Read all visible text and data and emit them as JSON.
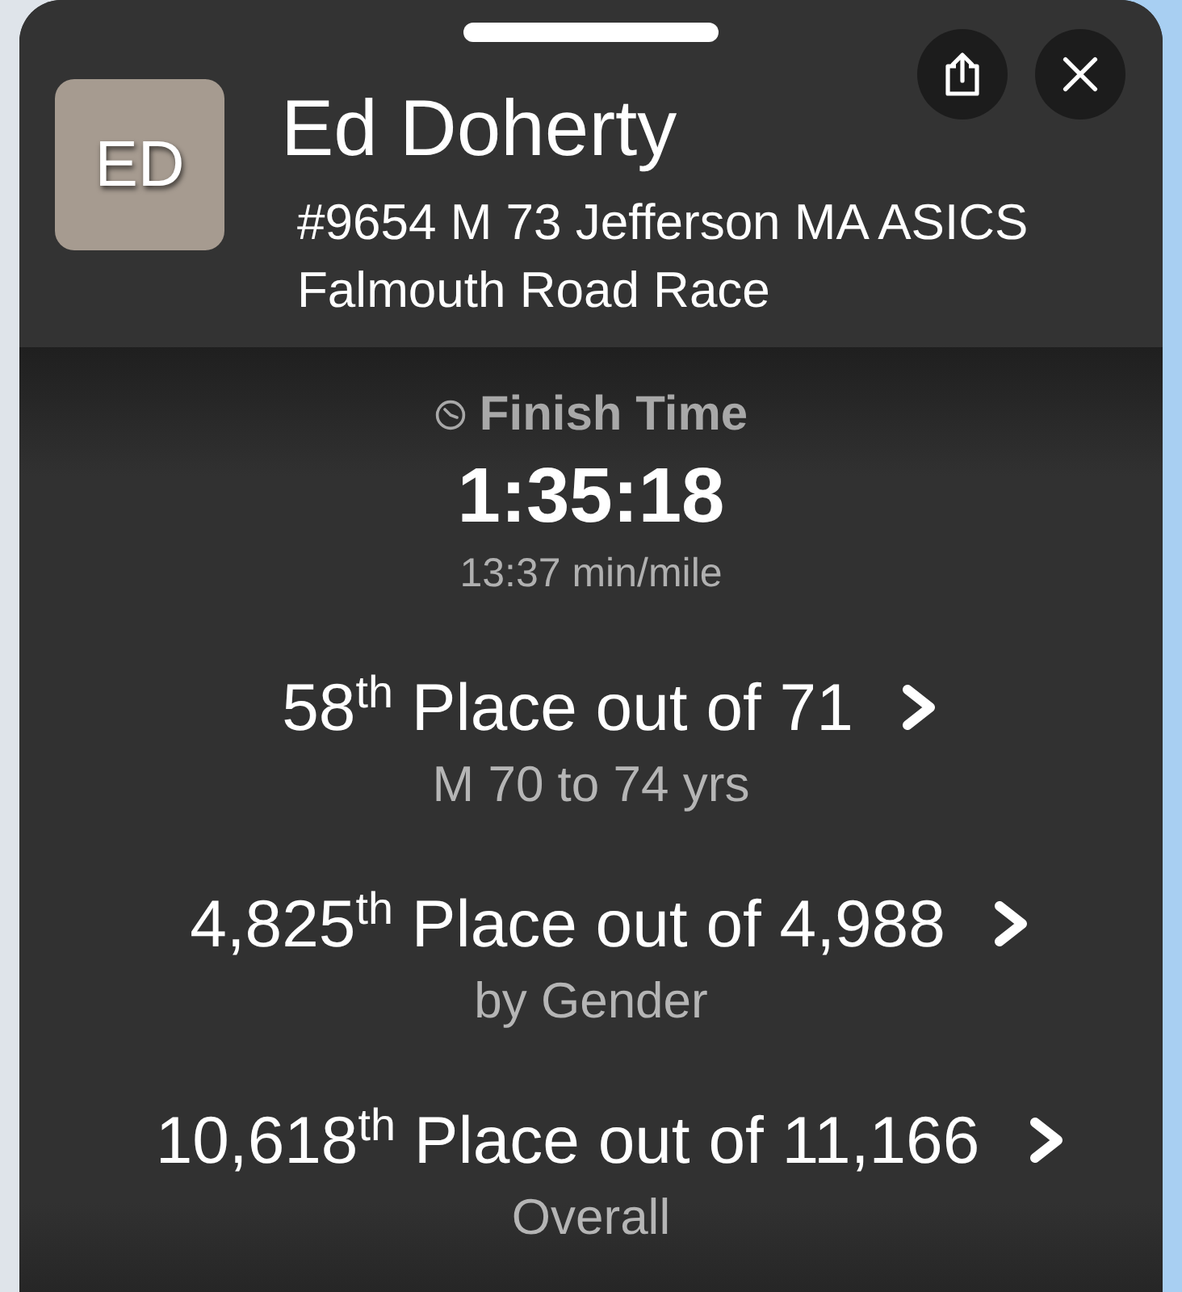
{
  "runner": {
    "initials": "ED",
    "name": "Ed Doherty",
    "entry": "#9654 M 73 Jefferson MA ASICS",
    "event": "Falmouth Road Race"
  },
  "finish": {
    "label": "Finish Time",
    "time": "1:35:18",
    "pace": "13:37 min/mile"
  },
  "placements": [
    {
      "title": "58$^{th}$ Place out of 71",
      "category": "M 70 to 74 yrs"
    },
    {
      "title": "4,825$^{th}$ Place out of 4,988",
      "category": "by Gender"
    },
    {
      "title": "10,618$^{th}$ Place out of 11,166",
      "category": "Overall"
    }
  ]
}
